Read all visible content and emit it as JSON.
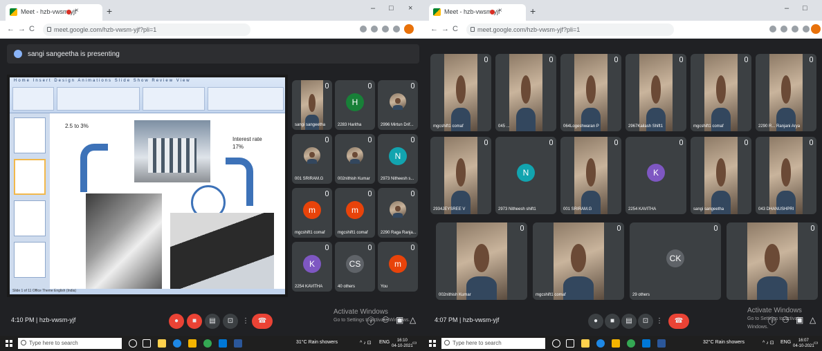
{
  "left": {
    "browser": {
      "tab_title": "Meet - hzb-vwsm-yjf",
      "tab_close": "×",
      "new_tab": "+",
      "window_controls": [
        "–",
        "□",
        "×"
      ],
      "nav": [
        "←",
        "→",
        "C"
      ],
      "url": "meet.google.com/hzb-vwsm-yjf?pli=1"
    },
    "presenting_banner": "sangi sangeetha is presenting",
    "slide": {
      "ribbon_menu": "Home  Insert  Design  Animations  Slide Show  Review  View",
      "text_rate_small": "2.5 to 3%",
      "text_interest_line1": "Interest rate",
      "text_interest_line2": "17%",
      "status": "Slide 1 of 11   Office Theme   English (India)"
    },
    "tiles": [
      {
        "name": "sangi sangeetha",
        "type": "video"
      },
      {
        "name": "2283 Haritha",
        "avatar": "H",
        "color": "#188038"
      },
      {
        "name": "2996 Mirtun Drif...",
        "type": "photo"
      },
      {
        "name": "001 SRIRAM.G",
        "type": "photo"
      },
      {
        "name": "002nithish Kumar",
        "type": "photo"
      },
      {
        "name": "2973 Nitheesh s...",
        "avatar": "N",
        "color": "#12a4af"
      },
      {
        "name": "mgcshift1 comaf",
        "avatar": "m",
        "color": "#e8430a"
      },
      {
        "name": "mgcshift1 comaf",
        "avatar": "m",
        "color": "#e8430a"
      },
      {
        "name": "2290 Raga Ranja...",
        "type": "photo"
      },
      {
        "name": "2254 KAVITHA",
        "avatar": "K",
        "color": "#7e57c2"
      },
      {
        "name": "40 others",
        "avatar": "CS",
        "color": "#5f6368"
      },
      {
        "name": "You",
        "avatar": "m",
        "color": "#e8430a"
      }
    ],
    "meeting_time": "4:10 PM  |  hzb-vwsm-yjf",
    "activate_title": "Activate Windows",
    "activate_sub": "Go to Settings to activate Windows.",
    "taskbar": {
      "search_placeholder": "Type here to search",
      "weather": "31°C  Rain showers",
      "lang": "ENG",
      "clock_time": "16:10",
      "clock_date": "04-10-2021"
    }
  },
  "right": {
    "browser": {
      "tab_title": "Meet - hzb-vwsm-yjf",
      "tab_close": "×",
      "new_tab": "+",
      "window_controls": [
        "–",
        "□"
      ],
      "nav": [
        "←",
        "→",
        "C"
      ],
      "url": "meet.google.com/hzb-vwsm-yjf?pli=1"
    },
    "tiles": [
      {
        "name": "mgcshift1 comaf",
        "type": "video"
      },
      {
        "name": "045 ...",
        "type": "video"
      },
      {
        "name": "064Logeshwaran P",
        "type": "video"
      },
      {
        "name": "2967Kailash Shift1",
        "type": "video"
      },
      {
        "name": "mgcshift1 comaf",
        "type": "video"
      },
      {
        "name": "2290 R... Ranjani Arya",
        "type": "video"
      },
      {
        "name": "2934JEYSREE V",
        "type": "video"
      },
      {
        "name": "2973 Nitheesh shift1",
        "avatar": "N",
        "color": "#12a4af"
      },
      {
        "name": "001 SRIRAM.G",
        "type": "video"
      },
      {
        "name": "2254 KAVITHA",
        "avatar": "K",
        "color": "#7e57c2"
      },
      {
        "name": "sangi sangeetha",
        "type": "video"
      },
      {
        "name": "043 DHANUSHPRI",
        "type": "video"
      },
      {
        "name": "002nithish Kumar",
        "type": "video"
      },
      {
        "name": "mgcshift1 comaf",
        "type": "video"
      },
      {
        "name": "29 others",
        "avatar": "CK",
        "color": "#5f6368"
      },
      {
        "name": "",
        "type": "video"
      }
    ],
    "meeting_time": "4:07 PM  |  hzb-vwsm-yjf",
    "activate_title": "Activate Windows",
    "activate_sub": "Go to Settings to activate Windows.",
    "taskbar": {
      "search_placeholder": "Type here to search",
      "weather": "32°C  Rain showers",
      "lang": "ENG",
      "clock_time": "16:07",
      "clock_date": "04-10-2021"
    }
  },
  "colors": {
    "meet_bg": "#202124",
    "tile_bg": "#3c4043",
    "end_call": "#ea4335",
    "chrome_tabbar": "#dee1e6"
  }
}
